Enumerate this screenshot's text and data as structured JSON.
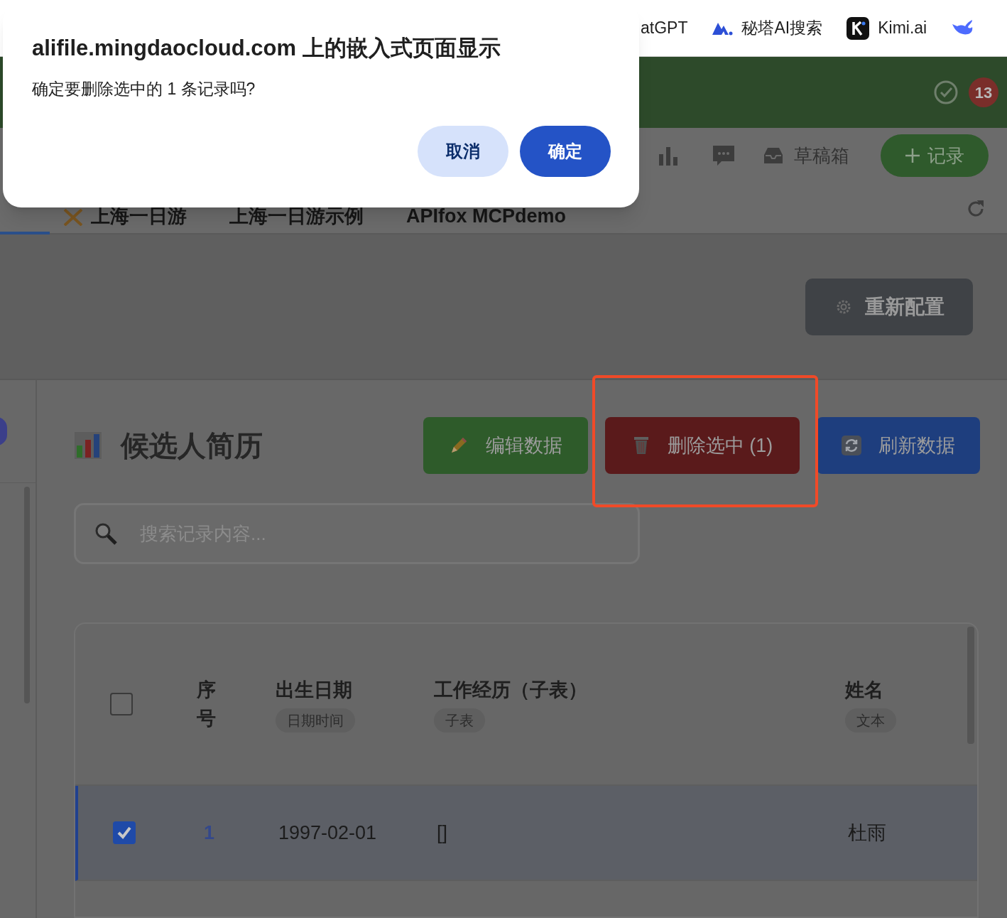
{
  "bookmarks": [
    {
      "kind": "plain",
      "label": "atGPT"
    },
    {
      "kind": "metaso",
      "label": "秘塔AI搜索"
    },
    {
      "kind": "kimi",
      "label": "Kimi.ai"
    },
    {
      "kind": "whale"
    }
  ],
  "header": {
    "badge": "13"
  },
  "toolbar": {
    "drafts": "草稿箱",
    "add_label": "记录"
  },
  "tabs": [
    {
      "label": "上海一日游",
      "selected": false
    },
    {
      "label": "上海一日游示例",
      "selected": false
    },
    {
      "label": "APIfox MCPdemo",
      "selected": false
    }
  ],
  "reconfigure_button": "重新配置",
  "panel": {
    "title": "候选人简历",
    "buttons": [
      {
        "kind": "edit",
        "label": "编辑数据"
      },
      {
        "kind": "delete",
        "label": "删除选中 (1)"
      },
      {
        "kind": "refresh",
        "label": "刷新数据"
      }
    ],
    "search": {
      "placeholder": "搜索记录内容..."
    }
  },
  "table": {
    "select_all_checked": false,
    "columns": [
      {
        "title": "序号"
      },
      {
        "title": "出生日期",
        "type": "日期时间"
      },
      {
        "title": "工作经历（子表）",
        "type": "子表"
      },
      {
        "title": "姓名",
        "type": "文本"
      }
    ],
    "rows": [
      {
        "checked": true,
        "selected": true,
        "cells": [
          "1",
          "1997-02-01",
          "[]",
          "杜雨"
        ]
      }
    ]
  },
  "dialog": {
    "title": "alifile.mingdaocloud.com 上的嵌入式页面显示",
    "message": "确定要删除选中的 1 条记录吗?",
    "buttons": [
      {
        "kind": "cancel",
        "label": "取消"
      },
      {
        "kind": "confirm",
        "label": "确定"
      }
    ]
  }
}
